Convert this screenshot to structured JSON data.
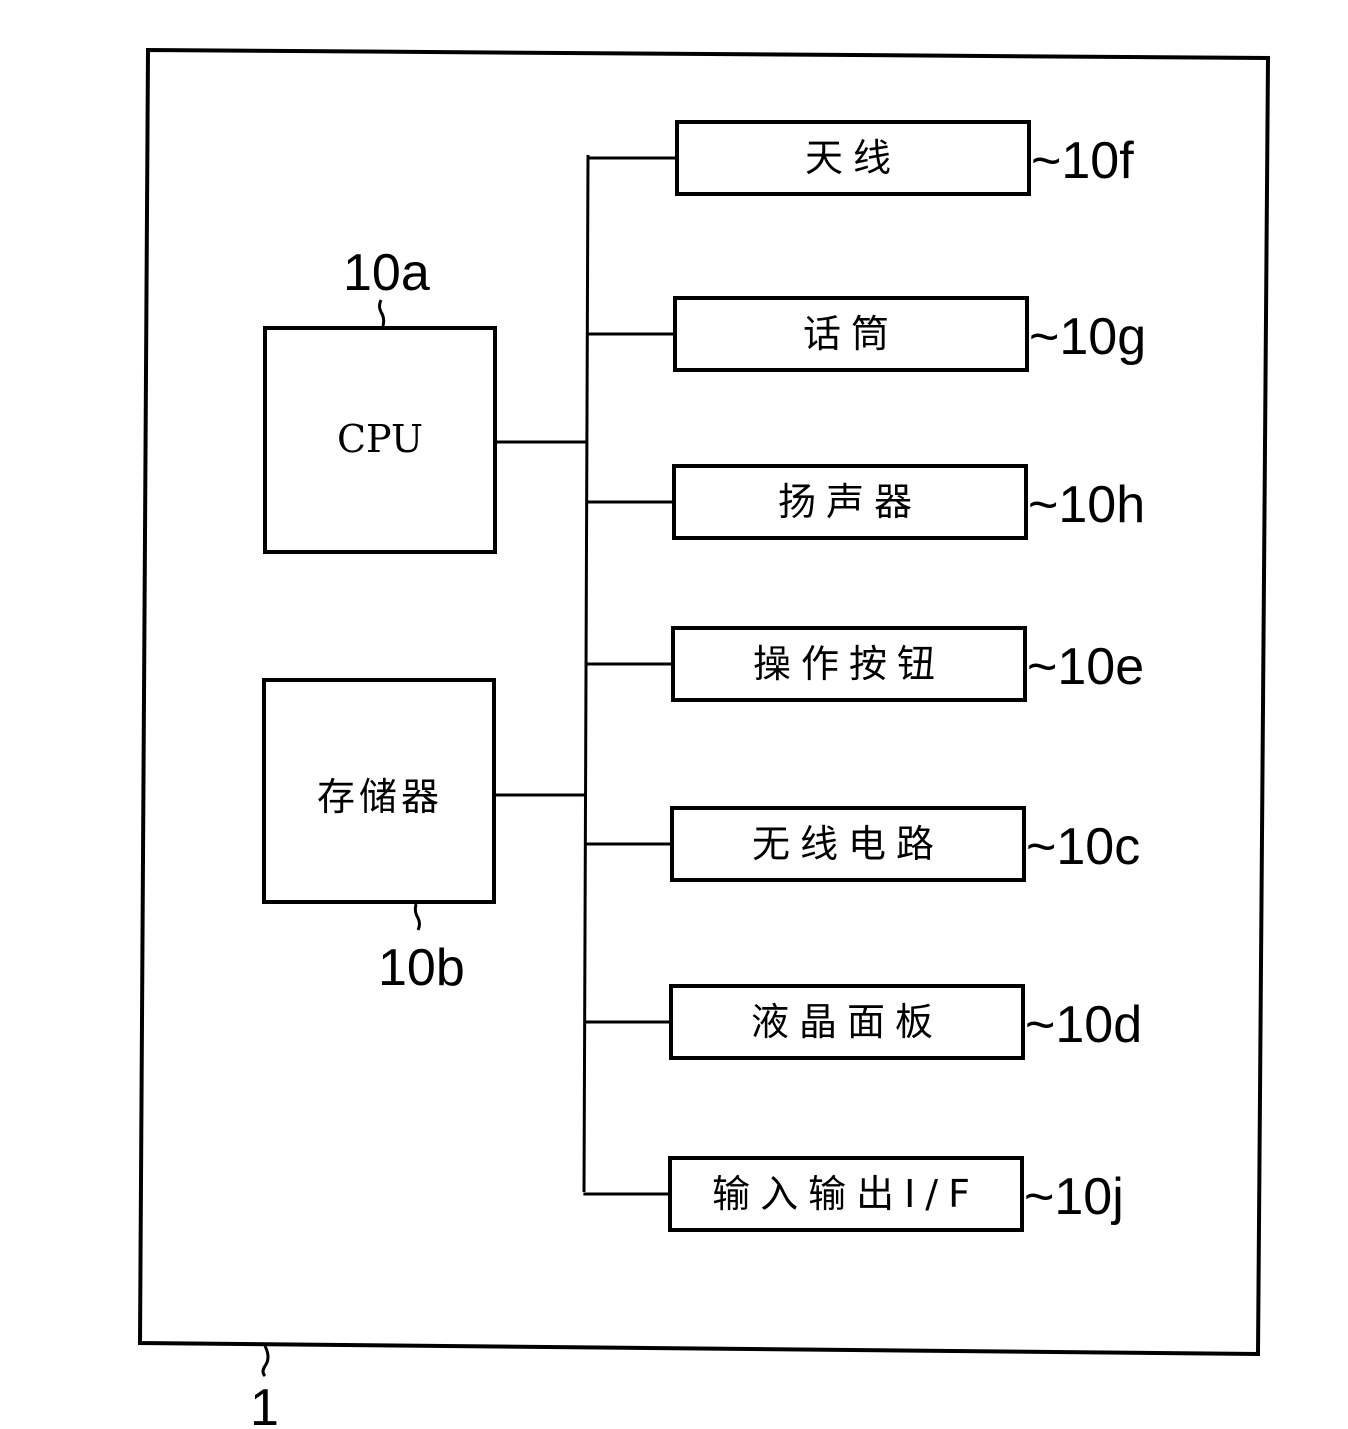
{
  "device": {
    "ref": "1"
  },
  "cpu": {
    "label": "CPU",
    "ref": "10a"
  },
  "memory": {
    "label": "存储器",
    "ref": "10b"
  },
  "components": [
    {
      "label": "天线",
      "ref": "10f"
    },
    {
      "label": "话筒",
      "ref": "10g"
    },
    {
      "label": "扬声器",
      "ref": "10h"
    },
    {
      "label": "操作按钮",
      "ref": "10e"
    },
    {
      "label": "无线电路",
      "ref": "10c"
    },
    {
      "label": "液晶面板",
      "ref": "10d"
    },
    {
      "label": "输入输出I/F",
      "ref": "10j"
    }
  ],
  "ref_prefix": "~"
}
